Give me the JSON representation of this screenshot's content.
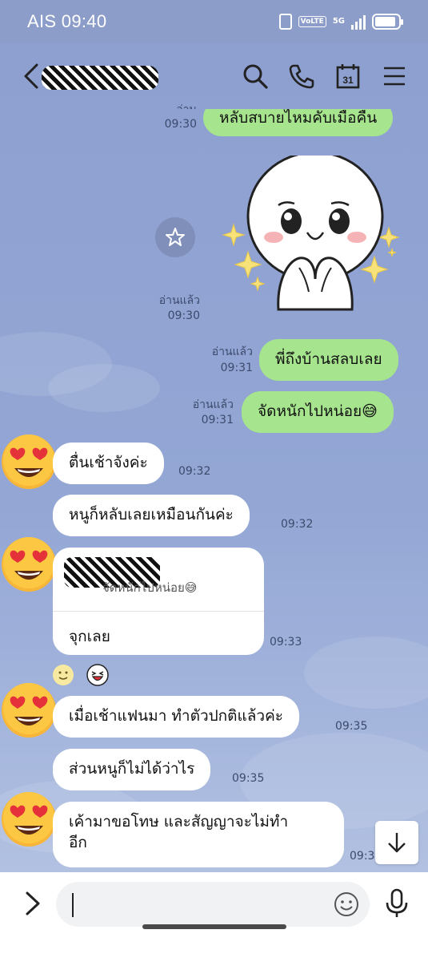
{
  "status_bar": {
    "carrier": "AIS",
    "time": "09:40",
    "volte": "VoLTE",
    "network": "5G",
    "icons": [
      "vibrate-icon",
      "volte-icon",
      "signal-icon",
      "battery-icon"
    ]
  },
  "header": {
    "icons": [
      "back-icon",
      "search-icon",
      "phone-icon",
      "calendar-icon",
      "menu-icon"
    ],
    "calendar_day": "31"
  },
  "messages": [
    {
      "side": "right",
      "text": "หลับสบายไหมคับเมื่อคืน",
      "read": "อ่านแล้ว",
      "time": "09:30"
    },
    {
      "side": "right",
      "type": "sticker",
      "sticker": "cony-pleading-sticker",
      "read": "อ่านแล้ว",
      "time": "09:30"
    },
    {
      "side": "right",
      "text": "พี่ถึงบ้านสลบเลย",
      "read": "อ่านแล้ว",
      "time": "09:31"
    },
    {
      "side": "right",
      "text": "จัดหนักไปหน่อย😅",
      "read": "อ่านแล้ว",
      "time": "09:31"
    },
    {
      "side": "left",
      "text": "ตื่นเช้าจังค่ะ",
      "time": "09:32"
    },
    {
      "side": "left",
      "text": "หนูก็หลับเลยเหมือนกันค่ะ",
      "time": "09:32"
    },
    {
      "side": "left",
      "type": "reply",
      "quoted": "จัดหนักไปหน่อย😅",
      "text": "จุกเลย",
      "time": "09:33"
    },
    {
      "side": "left",
      "text": "เมื่อเช้าแฟนมา ทำตัวปกติแล้วค่ะ",
      "time": "09:35"
    },
    {
      "side": "left",
      "text": "ส่วนหนูก็ไม่ได้ว่าไร",
      "time": "09:35"
    },
    {
      "side": "left",
      "text_line1": "เค้ามาขอโทษ และสัญญาจะไม่ทำ",
      "text_line2": "อีก",
      "time": "09:3"
    }
  ],
  "reactions": [
    "smiley-reaction",
    "laughing-reaction"
  ],
  "input": {
    "value": "",
    "placeholder": ""
  },
  "colors": {
    "chat_background": "#93a6d4",
    "sent_bubble": "#a6e48e",
    "received_bubble": "#ffffff",
    "status_bar": "#8c9dca"
  }
}
